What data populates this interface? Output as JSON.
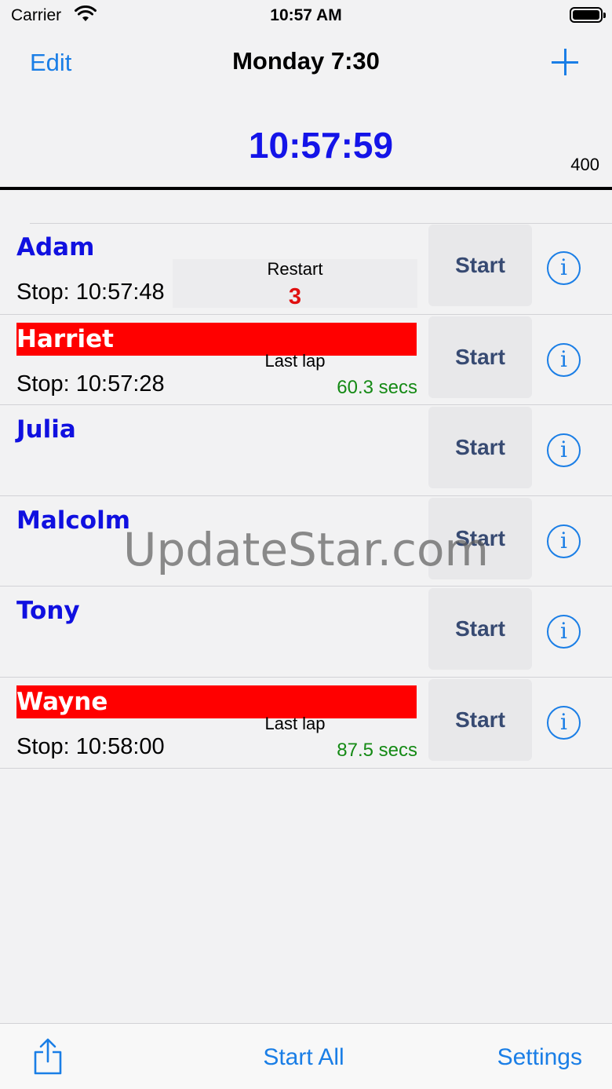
{
  "status_bar": {
    "carrier": "Carrier",
    "time": "10:57 AM"
  },
  "nav": {
    "edit_label": "Edit",
    "title": "Monday 7:30",
    "add_icon": "plus-icon"
  },
  "header": {
    "clock": "10:57:59",
    "distance": "400"
  },
  "runners": [
    {
      "name": "Adam",
      "stop": "Stop: 10:57:48",
      "mid_label": "Restart",
      "mid_value": "3",
      "start_label": "Start"
    },
    {
      "name": "Harriet",
      "stop": "Stop: 10:57:28",
      "mid_label": "Last lap",
      "mid_value": "60.3 secs",
      "start_label": "Start"
    },
    {
      "name": "Julia",
      "stop": "",
      "mid_label": "",
      "mid_value": "",
      "start_label": "Start"
    },
    {
      "name": "Malcolm",
      "stop": "",
      "mid_label": "",
      "mid_value": "",
      "start_label": "Start"
    },
    {
      "name": "Tony",
      "stop": "",
      "mid_label": "",
      "mid_value": "",
      "start_label": "Start"
    },
    {
      "name": "Wayne",
      "stop": "Stop: 10:58:00",
      "mid_label": "Last lap",
      "mid_value": "87.5 secs",
      "start_label": "Start"
    }
  ],
  "info_glyph": "i",
  "watermark": "UpdateStar.com",
  "tab_bar": {
    "share_icon": "share-icon",
    "start_all_label": "Start All",
    "settings_label": "Settings"
  },
  "colors": {
    "accent": "#1a7ee6",
    "clock": "#1414e8",
    "alert": "#ff0000",
    "lap": "#158a15",
    "count": "#e01010"
  }
}
